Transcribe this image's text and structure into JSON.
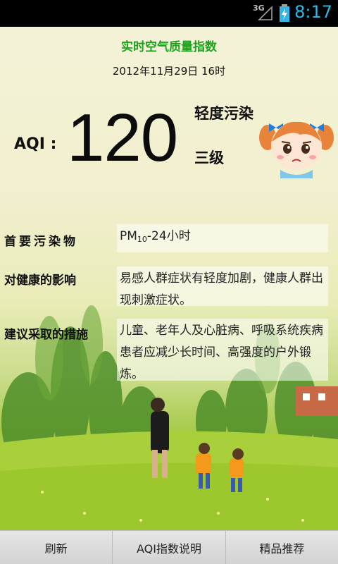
{
  "status_bar": {
    "network_type": "3G",
    "time": "8:17",
    "icons": [
      "signal-icon",
      "battery-charging-icon"
    ]
  },
  "header": {
    "title": "实时空气质量指数",
    "timestamp": "2012年11月29日 16时"
  },
  "aqi": {
    "label": "AQI :",
    "value": "120",
    "level": "轻度污染",
    "grade": "三级",
    "mascot": "worried-girl-mascot"
  },
  "info": {
    "primary_pollutant": {
      "label": "首要污染物",
      "value_prefix": "PM",
      "value_sub": "10",
      "value_suffix": "-24小时"
    },
    "health_effect": {
      "label": "对健康的影响",
      "value": "易感人群症状有轻度加剧，健康人群出现刺激症状。"
    },
    "recommendation": {
      "label": "建议采取的措施",
      "value": "儿童、老年人及心脏病、呼吸系统疾病患者应减少长时间、高强度的户外锻炼。"
    }
  },
  "bottom_nav": {
    "refresh": "刷新",
    "aqi_explain": "AQI指数说明",
    "recommend": "精品推荐"
  },
  "colors": {
    "title_green": "#1fa31f",
    "status_blue": "#33b5e5"
  }
}
